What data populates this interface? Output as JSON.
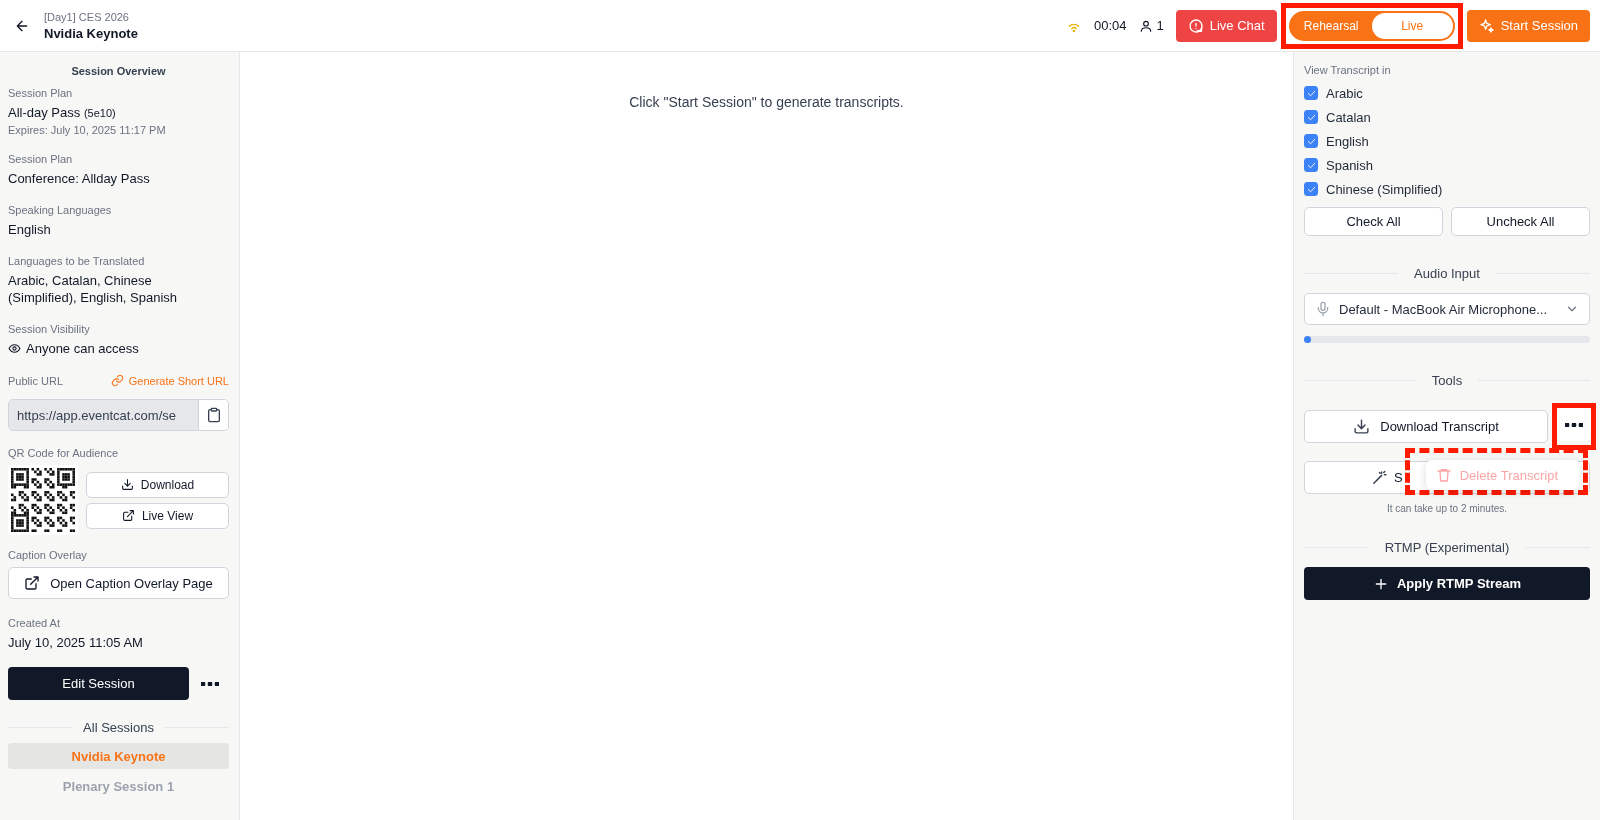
{
  "header": {
    "breadcrumb": "[Day1] CES 2026",
    "title": "Nvidia Keynote",
    "timer": "00:04",
    "viewers": "1",
    "live_chat": "Live Chat",
    "mode_toggle": {
      "annotation": {
        "kind": "solid"
      },
      "options": [
        {
          "label": "Rehearsal",
          "selected": false
        },
        {
          "label": "Live",
          "selected": true
        }
      ]
    },
    "start_button": "Start Session"
  },
  "sidebar": {
    "heading": "Session Overview",
    "fields": [
      {
        "kind": "plan",
        "label": "Session Plan",
        "value": "All-day Pass",
        "tag": "(5e10)",
        "note": "Expires: July 10, 2025 11:17 PM"
      },
      {
        "kind": "text",
        "label": "Session Plan",
        "value": "Conference: Allday Pass"
      },
      {
        "kind": "text",
        "label": "Speaking Languages",
        "value": "English"
      },
      {
        "kind": "text",
        "label": "Languages to be Translated",
        "value": "Arabic, Catalan, Chinese (Simplified), English, Spanish"
      },
      {
        "kind": "visibility",
        "label": "Session Visibility",
        "value": "Anyone can access"
      }
    ],
    "public_url": {
      "label": "Public URL",
      "link": "Generate Short URL",
      "value": "https://app.eventcat.com/se"
    },
    "qr": {
      "label": "QR Code for Audience",
      "download": "Download",
      "live_view": "Live View"
    },
    "caption": {
      "label": "Caption Overlay",
      "button": "Open Caption Overlay Page"
    },
    "created": {
      "label": "Created At",
      "value": "July 10, 2025 11:05 AM"
    },
    "edit_button": "Edit Session",
    "all_sessions": {
      "heading": "All Sessions",
      "items": [
        {
          "label": "Nvidia Keynote",
          "selected": true
        },
        {
          "label": "Plenary Session 1",
          "selected": false
        }
      ]
    }
  },
  "main": {
    "message": "Click \"Start Session\" to generate transcripts."
  },
  "panel": {
    "view_label": "View Transcript in",
    "languages": [
      {
        "label": "Arabic",
        "checked": true
      },
      {
        "label": "Catalan",
        "checked": true
      },
      {
        "label": "English",
        "checked": true
      },
      {
        "label": "Spanish",
        "checked": true
      },
      {
        "label": "Chinese (Simplified)",
        "checked": true
      }
    ],
    "check_all": "Check All",
    "uncheck_all": "Uncheck All",
    "audio_heading": "Audio Input",
    "audio_device": "Default - MacBook Air Microphone...",
    "audio_level": {
      "level": 0.01
    },
    "tools_heading": "Tools",
    "download": "Download Transcript",
    "more_button": {
      "annotation": {
        "kind": "solid"
      }
    },
    "summary_button": "S",
    "note": "It can take up to 2 minutes.",
    "menu": {
      "annotation": {
        "kind": "dashed"
      },
      "items": [
        {
          "label": "Delete Transcript",
          "disabled": true
        }
      ]
    },
    "rtmp_heading": "RTMP (Experimental)",
    "rtmp_button": "Apply RTMP Stream"
  }
}
